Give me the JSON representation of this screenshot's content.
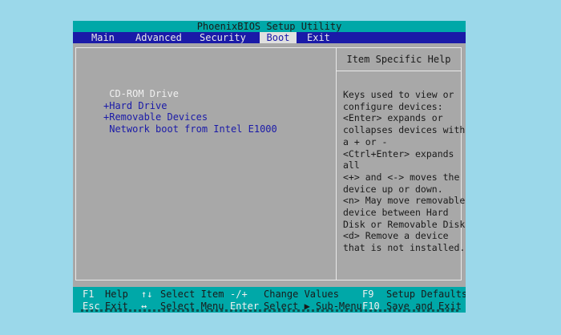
{
  "title": "PhoenixBIOS Setup Utility",
  "menu": [
    {
      "label": "Main",
      "active": false
    },
    {
      "label": "Advanced",
      "active": false
    },
    {
      "label": "Security",
      "active": false
    },
    {
      "label": "Boot",
      "active": true
    },
    {
      "label": "Exit",
      "active": false
    }
  ],
  "boot_items": [
    {
      "label": " CD-ROM Drive",
      "selected": true
    },
    {
      "label": "+Hard Drive",
      "selected": false
    },
    {
      "label": "+Removable Devices",
      "selected": false
    },
    {
      "label": " Network boot from Intel E1000",
      "selected": false
    }
  ],
  "help": {
    "title": "Item Specific Help",
    "text": "Keys used to view or\nconfigure devices:\n<Enter> expands or\ncollapses devices with\na + or -\n<Ctrl+Enter> expands\nall\n<+> and <-> moves the\ndevice up or down.\n<n> May move removable\ndevice between Hard\nDisk or Removable Disk\n<d> Remove a device\nthat is not installed."
  },
  "status": {
    "row1": {
      "k1": "F1",
      "d1": "Help",
      "k2": "↑↓",
      "d2": "Select Item",
      "k3": "-/+",
      "d3": "Change Values",
      "k4": "F9",
      "d4": "Setup Defaults"
    },
    "row2": {
      "k1": "Esc",
      "d1": "Exit",
      "k2": "↔",
      "d2": "Select Menu",
      "k3": "Enter",
      "d3": "Select ▶ Sub-Menu",
      "k4": "F10",
      "d4": "Save and Exit"
    }
  }
}
